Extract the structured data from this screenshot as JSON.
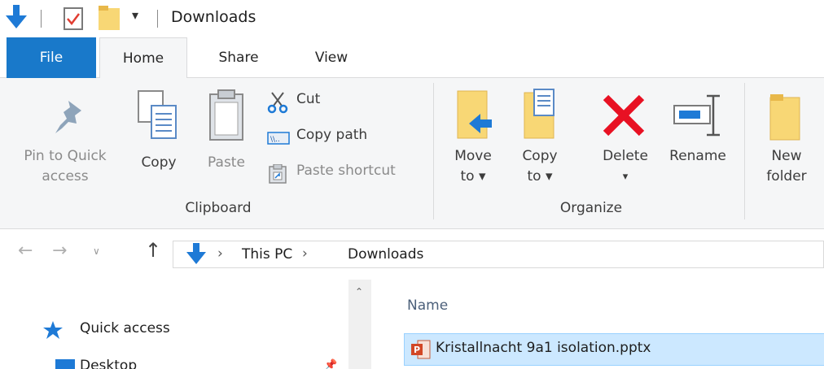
{
  "window": {
    "title": "Downloads"
  },
  "tabs": [
    {
      "label": "File"
    },
    {
      "label": "Home"
    },
    {
      "label": "Share"
    },
    {
      "label": "View"
    }
  ],
  "ribbon": {
    "clipboard": {
      "pin_line1": "Pin to Quick",
      "pin_line2": "access",
      "copy": "Copy",
      "paste": "Paste",
      "cut": "Cut",
      "copy_path": "Copy path",
      "paste_shortcut": "Paste shortcut",
      "group": "Clipboard"
    },
    "organize": {
      "move_line1": "Move",
      "move_line2": "to ▾",
      "copy_line1": "Copy",
      "copy_line2": "to ▾",
      "delete": "Delete",
      "delete_arrow": "▾",
      "rename": "Rename",
      "group": "Organize"
    },
    "new": {
      "folder_line1": "New",
      "folder_line2": "folder"
    }
  },
  "address": {
    "crumbs": [
      "This PC",
      "Downloads"
    ],
    "separator": "›"
  },
  "nav": {
    "quick_access": "Quick access",
    "desktop": "Desktop"
  },
  "files": {
    "column_name": "Name",
    "items": [
      {
        "name": "Kristallnacht 9a1 isolation.pptx"
      }
    ]
  },
  "colors": {
    "file_tab": "#1979ca",
    "ribbon_bg": "#f5f6f7",
    "selection": "#cce8ff",
    "delete_red": "#e81123",
    "folder_yellow": "#f8d775"
  }
}
